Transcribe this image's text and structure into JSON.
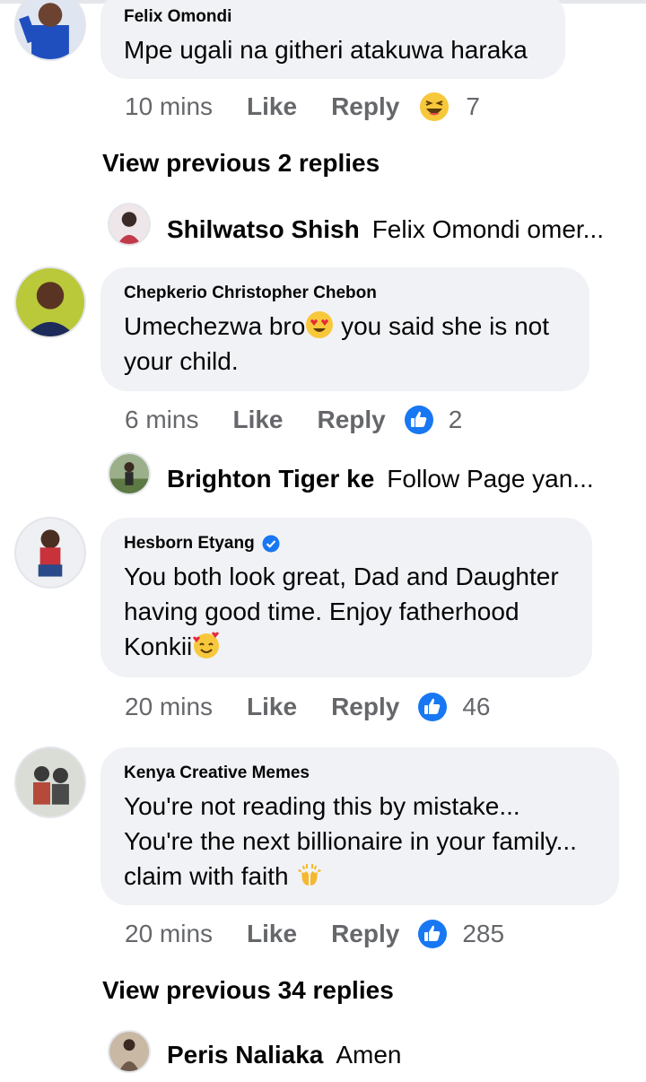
{
  "comments": [
    {
      "author": "Felix Omondi",
      "text": "Mpe ugali na githeri atakuwa haraka",
      "time": "10 mins",
      "like": "Like",
      "reply": "Reply",
      "reaction": "laughing-emoji",
      "count": "7"
    },
    {
      "author": "Chepkerio Christopher Chebon",
      "text_before": "Umechezwa bro",
      "text_after": " you said she is not\nyour child.",
      "inline_emoji": "heart-eyes-emoji",
      "time": "6 mins",
      "like": "Like",
      "reply": "Reply",
      "reaction": "like-thumb",
      "count": "2"
    },
    {
      "author": "Hesborn Etyang",
      "verified": true,
      "text": "You both look great, Dad and Daughter\nhaving good time. Enjoy fatherhood\nKonkii",
      "inline_emoji": "smiling-hearts-emoji",
      "time": "20 mins",
      "like": "Like",
      "reply": "Reply",
      "reaction": "like-thumb",
      "count": "46"
    },
    {
      "author": "Kenya Creative Memes",
      "text": "You're not reading this by mistake...\nYou're the next billionaire in your family...\nclaim with faith ",
      "inline_emoji": "open-hands-emoji",
      "time": "20 mins",
      "like": "Like",
      "reply": "Reply",
      "reaction": "like-thumb",
      "count": "285"
    }
  ],
  "view_previous": [
    "View previous 2 replies",
    "View previous 34 replies"
  ],
  "replies": [
    {
      "name": "Shilwatso Shish",
      "text": "Felix Omondi omer..."
    },
    {
      "name": "Brighton Tiger ke",
      "text": "Follow Page yan..."
    },
    {
      "name": "Peris Naliaka",
      "text": "Amen"
    }
  ],
  "colors": {
    "bubble": "#f0f2f5",
    "secondary_text": "#65676b",
    "like_blue": "#1877f2"
  }
}
